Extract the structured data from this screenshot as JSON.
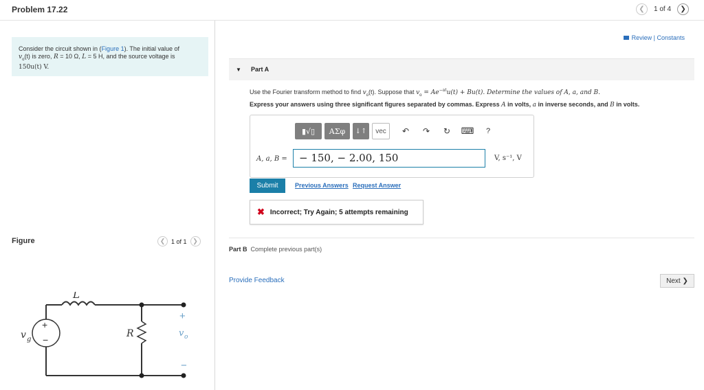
{
  "header": {
    "title": "Problem 17.22",
    "pager_text": "1 of 4"
  },
  "intro": {
    "text_before_link": "Consider the circuit shown in (",
    "figure_link": "Figure 1",
    "text_after_link": "). The initial value of",
    "line2_a": "v",
    "line2_b": "(t) is zero, ",
    "line2_R": "R",
    "line2_c": " = 10 Ω, ",
    "line2_L": "L",
    "line2_d": " = 5 H, and the source voltage is",
    "line3": "150u(t) V."
  },
  "figure": {
    "label": "Figure",
    "pager_text": "1 of 1",
    "labels": {
      "inductor": "L",
      "resistor": "R",
      "source": "v",
      "source_sub": "g",
      "output": "v",
      "output_sub": "o",
      "plus": "+",
      "minus": "−"
    }
  },
  "review": {
    "label": "Review | Constants"
  },
  "part_a": {
    "label": "Part A",
    "question_a": "Use the Fourier transform method to find ",
    "question_var": "v",
    "question_b": "(t). Suppose that ",
    "question_eq": "v",
    "question_c": " = Ae",
    "question_exp": "−at",
    "question_d": "u(t) + Bu(t). Determine the values of ",
    "question_e": "A, a, and B.",
    "instruction_a": "Express your answers using three significant figures separated by commas. Express ",
    "instruction_A": "A",
    "instruction_b": " in volts, ",
    "instruction_a_var": "a",
    "instruction_c": " in inverse seconds, and ",
    "instruction_B": "B",
    "instruction_d": " in volts.",
    "toolbar": {
      "templates": "▮√▯",
      "greek": "ΑΣφ",
      "sort": "↓↑",
      "vec": "vec",
      "undo": "↶",
      "redo": "↷",
      "reset": "↻",
      "keyboard": "⌨",
      "help": "?"
    },
    "answer_label": "A, a, B =",
    "answer_value": "− 150, − 2.00, 150",
    "units": "V, s⁻¹, V",
    "submit": "Submit",
    "previous_answers": "Previous Answers",
    "request_answer": "Request Answer",
    "feedback_icon": "✖",
    "feedback": "Incorrect; Try Again; 5 attempts remaining"
  },
  "part_b": {
    "label": "Part B",
    "text": "Complete previous part(s)"
  },
  "footer": {
    "provide_feedback": "Provide Feedback",
    "next": "Next ❯"
  }
}
